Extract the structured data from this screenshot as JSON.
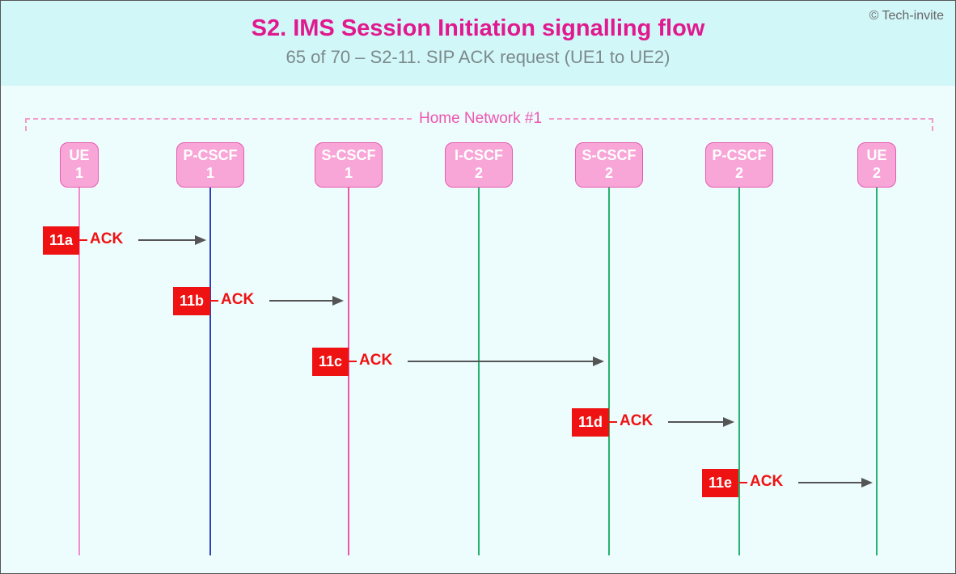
{
  "copyright": "© Tech-invite",
  "title": "S2. IMS Session Initiation signalling flow",
  "subtitle": "65 of 70 – S2-11. SIP ACK request (UE1 to UE2)",
  "network_label": "Home Network #1",
  "nodes": {
    "ue1": {
      "line1": "UE",
      "line2": "1"
    },
    "pcscf1": {
      "line1": "P-CSCF",
      "line2": "1"
    },
    "scscf1": {
      "line1": "S-CSCF",
      "line2": "1"
    },
    "icscf2": {
      "line1": "I-CSCF",
      "line2": "2"
    },
    "scscf2": {
      "line1": "S-CSCF",
      "line2": "2"
    },
    "pcscf2": {
      "line1": "P-CSCF",
      "line2": "2"
    },
    "ue2": {
      "line1": "UE",
      "line2": "2"
    }
  },
  "messages": {
    "m1": {
      "step": "11a",
      "label": "ACK"
    },
    "m2": {
      "step": "11b",
      "label": "ACK"
    },
    "m3": {
      "step": "11c",
      "label": "ACK"
    },
    "m4": {
      "step": "11d",
      "label": "ACK"
    },
    "m5": {
      "step": "11e",
      "label": "ACK"
    }
  },
  "chart_data": {
    "type": "sequence-diagram",
    "title": "S2. IMS Session Initiation signalling flow",
    "subtitle": "65 of 70 – S2-11. SIP ACK request (UE1 to UE2)",
    "group": {
      "label": "Home Network #1",
      "participants": [
        "P-CSCF 1",
        "S-CSCF 1",
        "I-CSCF 2",
        "S-CSCF 2",
        "P-CSCF 2"
      ]
    },
    "participants": [
      "UE 1",
      "P-CSCF 1",
      "S-CSCF 1",
      "I-CSCF 2",
      "S-CSCF 2",
      "P-CSCF 2",
      "UE 2"
    ],
    "messages": [
      {
        "step": "11a",
        "from": "UE 1",
        "to": "P-CSCF 1",
        "label": "ACK"
      },
      {
        "step": "11b",
        "from": "P-CSCF 1",
        "to": "S-CSCF 1",
        "label": "ACK"
      },
      {
        "step": "11c",
        "from": "S-CSCF 1",
        "to": "S-CSCF 2",
        "label": "ACK"
      },
      {
        "step": "11d",
        "from": "S-CSCF 2",
        "to": "P-CSCF 2",
        "label": "ACK"
      },
      {
        "step": "11e",
        "from": "P-CSCF 2",
        "to": "UE 2",
        "label": "ACK"
      }
    ]
  }
}
